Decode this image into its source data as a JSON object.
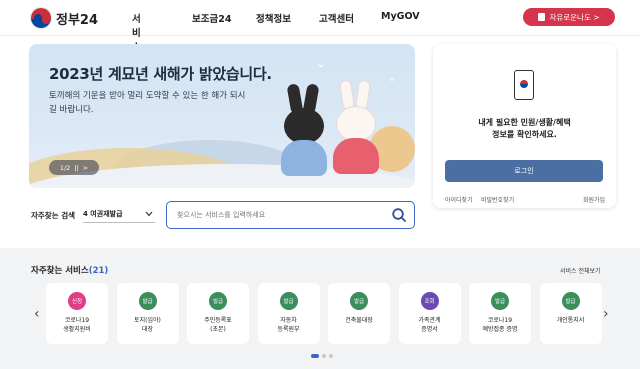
{
  "header": {
    "logo_text": "정부24",
    "nav": [
      "서비스",
      "보조금24",
      "정책정보",
      "고객센터",
      "MyGOV"
    ],
    "cta_label": "자유로운나도 >"
  },
  "banner": {
    "title": "2023년 계묘년 새해가 밝았습니다.",
    "subtitle": "토끼해의 기운을 받아 멀리 도약할 수 있는 한 해가 되시길 바랍니다.",
    "pager_text": "1/2",
    "pager_pause": "||",
    "pager_next": ">"
  },
  "login_card": {
    "message_line1": "내게 필요한 민원/생활/혜택",
    "message_line2": "정보를 확인하세요.",
    "login_button": "로그인",
    "link_find_id": "아이디찾기",
    "link_find_pw": "비밀번호찾기",
    "link_signup": "회원가입"
  },
  "search": {
    "label": "자주찾는 검색",
    "select_value": "4 여권재발급",
    "placeholder": "찾으시는 서비스를 입력하세요"
  },
  "services": {
    "title": "자주찾는 서비스",
    "count": "(21)",
    "view_all": "서비스 전체보기",
    "prev": "‹",
    "next": "›",
    "items": [
      {
        "badge": "신청",
        "name": "코로나19\n생활지원비",
        "color": "#e23e86"
      },
      {
        "badge": "발급",
        "name": "토지(임야)\n대장",
        "color": "#3a8f5c"
      },
      {
        "badge": "발급",
        "name": "주민등록표\n(초본)",
        "color": "#3a8f5c"
      },
      {
        "badge": "발급",
        "name": "자동차\n등록원부",
        "color": "#3a8f5c"
      },
      {
        "badge": "발급",
        "name": "건축물대장",
        "color": "#3a8f5c"
      },
      {
        "badge": "조회",
        "name": "가족관계\n증명서",
        "color": "#6a4bb6"
      },
      {
        "badge": "발급",
        "name": "코로나19\n예방접종 증명",
        "color": "#3a8f5c"
      },
      {
        "badge": "발급",
        "name": "개인통지서",
        "color": "#3a8f5c"
      }
    ]
  },
  "colors": {
    "accent": "#3d66c4",
    "cta": "#d6344a",
    "login_button": "#4b6ea3"
  }
}
